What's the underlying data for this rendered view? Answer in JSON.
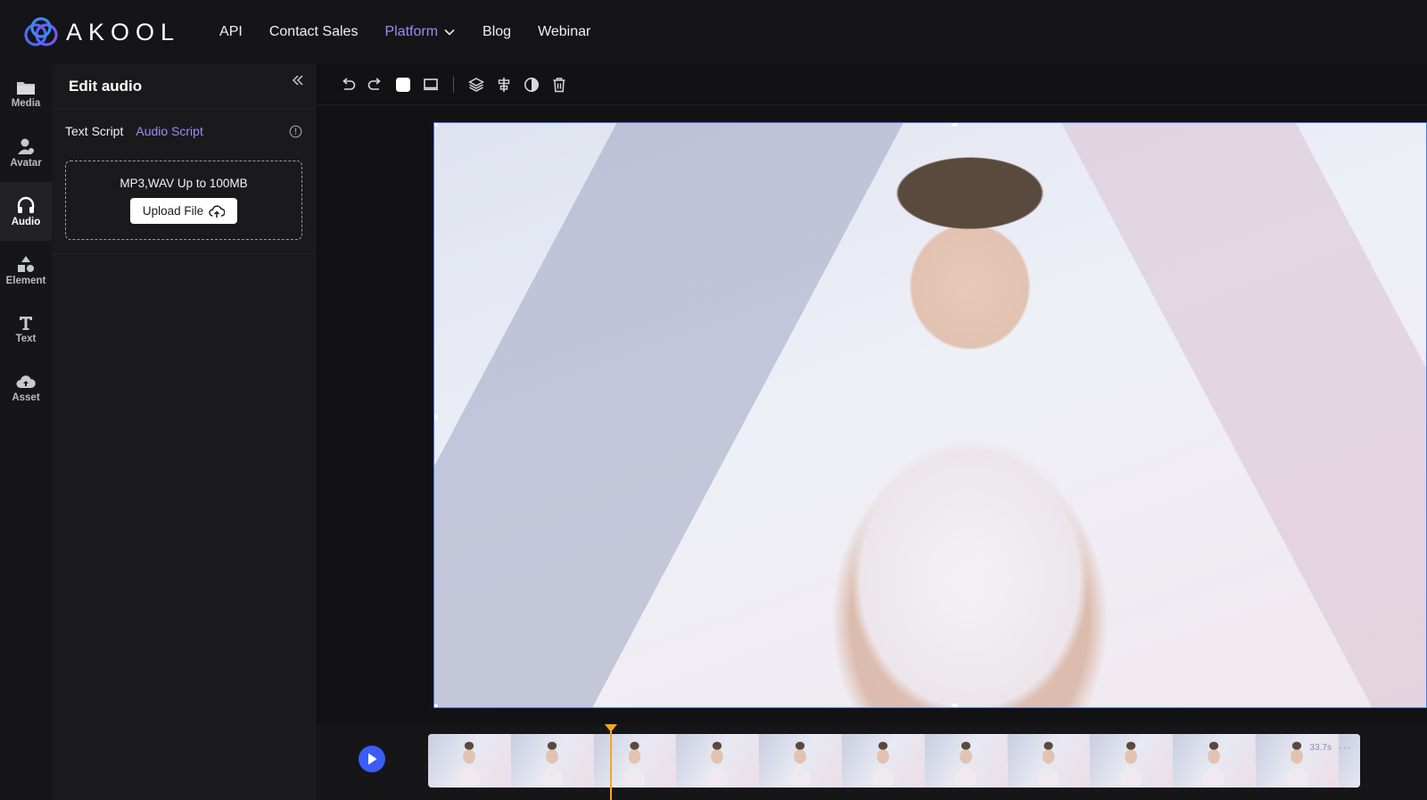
{
  "brand": {
    "name": "AKOOL"
  },
  "nav": {
    "items": [
      {
        "label": "API"
      },
      {
        "label": "Contact Sales"
      },
      {
        "label": "Platform"
      },
      {
        "label": "Blog"
      },
      {
        "label": "Webinar"
      }
    ],
    "accent_color": "#9a8cf5"
  },
  "rail": {
    "items": [
      {
        "label": "Media",
        "icon": "folder-icon"
      },
      {
        "label": "Avatar",
        "icon": "avatar-icon"
      },
      {
        "label": "Audio",
        "icon": "headphones-icon",
        "active": true
      },
      {
        "label": "Element",
        "icon": "shapes-icon"
      },
      {
        "label": "Text",
        "icon": "text-icon"
      },
      {
        "label": "Asset",
        "icon": "cloud-upload-icon"
      }
    ]
  },
  "panel": {
    "title": "Edit audio",
    "tabs": [
      {
        "label": "Text Script"
      },
      {
        "label": "Audio Script",
        "active": true
      }
    ],
    "dropzone": {
      "hint": "MP3,WAV Up to 100MB",
      "button_label": "Upload File"
    }
  },
  "toolbar": {
    "icons": [
      "undo-icon",
      "redo-icon",
      "portrait-ratio-icon",
      "landscape-ratio-icon",
      "layers-icon",
      "align-icon",
      "contrast-icon",
      "trash-icon"
    ]
  },
  "timeline": {
    "duration": "33.7s",
    "play_color": "#3b5cf6",
    "playhead_color": "#f5a524"
  }
}
